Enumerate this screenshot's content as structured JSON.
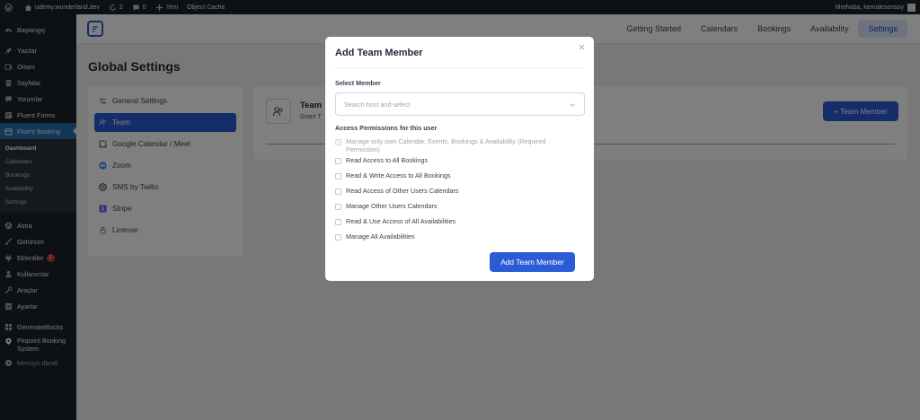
{
  "adminbar": {
    "site_name": "udemy.wunderland.dev",
    "updates_count": "2",
    "comments_count": "0",
    "new_label": "Yeni",
    "cache_label": "Object Cache",
    "greeting": "Merhaba, kemalesensoy"
  },
  "sidebar": {
    "items_top": [
      {
        "label": "Başlangıç",
        "icon": "dashboard-icon"
      }
    ],
    "items_main": [
      {
        "label": "Yazılar",
        "icon": "pin-icon"
      },
      {
        "label": "Ortam",
        "icon": "media-icon"
      },
      {
        "label": "Sayfalar",
        "icon": "page-icon"
      },
      {
        "label": "Yorumlar",
        "icon": "comment-icon"
      },
      {
        "label": "Fluent Forms",
        "icon": "form-icon"
      }
    ],
    "current": {
      "label": "Fluent Booking",
      "icon": "calendar-icon"
    },
    "submenu": [
      "Dashboard",
      "Calendars",
      "Bookings",
      "Availability",
      "Settings"
    ],
    "items_after": [
      {
        "label": "Astra",
        "icon": "astra-icon"
      },
      {
        "label": "Görünüm",
        "icon": "brush-icon"
      },
      {
        "label": "Eklentiler",
        "icon": "plugin-icon",
        "badge": "2"
      },
      {
        "label": "Kullanıcılar",
        "icon": "users-icon"
      },
      {
        "label": "Araçlar",
        "icon": "wrench-icon"
      },
      {
        "label": "Ayarlar",
        "icon": "settings-icon"
      }
    ],
    "items_bottom": [
      {
        "label": "GenerateBlocks",
        "icon": "blocks-icon"
      },
      {
        "label": "Pinpoint Booking System",
        "icon": "pinpoint-icon"
      }
    ],
    "collapse_label": "Menüyü daralt"
  },
  "topnav": {
    "links": [
      "Getting Started",
      "Calendars",
      "Bookings",
      "Availability",
      "Settings"
    ],
    "active": "Settings"
  },
  "page_title": "Global Settings",
  "settings_menu": [
    {
      "label": "General Settings",
      "icon": "sliders-icon"
    },
    {
      "label": "Team",
      "icon": "team-icon",
      "active": true
    },
    {
      "label": "Google Calendar / Meet",
      "icon": "google-calendar-icon"
    },
    {
      "label": "Zoom",
      "icon": "zoom-icon"
    },
    {
      "label": "SMS by Twilio",
      "icon": "twilio-icon"
    },
    {
      "label": "Stripe",
      "icon": "stripe-icon"
    },
    {
      "label": "License",
      "icon": "lock-icon"
    }
  ],
  "team_card": {
    "title": "Team",
    "subtitle": "Grant T",
    "button_label": "+ Team Member"
  },
  "modal": {
    "title": "Add Team Member",
    "select_label": "Select Member",
    "select_placeholder": "Search host and select",
    "permissions_label": "Access Permissions for this user",
    "permissions": [
      {
        "label": "Manage only own Calendar, Events, Bookings & Availability (Required Permission)",
        "disabled": true
      },
      {
        "label": "Read Access to All Bookings"
      },
      {
        "label": "Read & Write Access to All Bookings"
      },
      {
        "label": "Read Access of Other Users Calendars"
      },
      {
        "label": "Manage Other Users Calendars"
      },
      {
        "label": "Read & Use Access of All Availabilities"
      },
      {
        "label": "Manage All Availabilities"
      }
    ],
    "submit_label": "Add Team Member"
  },
  "colors": {
    "admin_dark": "#1d2327",
    "admin_blue": "#2271b1",
    "primary": "#2c5bd6",
    "badge_red": "#d63638"
  }
}
